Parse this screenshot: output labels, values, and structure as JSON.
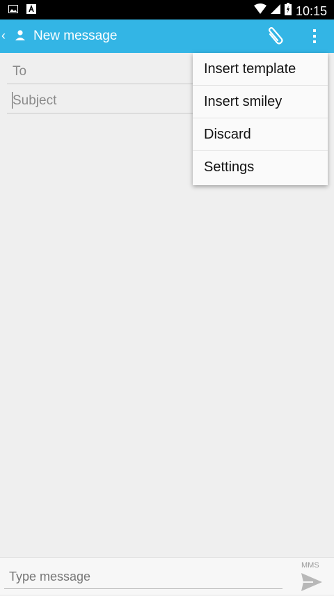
{
  "status_bar": {
    "time": "10:15",
    "icons": [
      "image-notification-icon",
      "a-notification-icon",
      "wifi-icon",
      "cell-signal-icon",
      "battery-icon"
    ]
  },
  "app_bar": {
    "title": "New message",
    "icons": [
      "back-chevron-icon",
      "person-icon",
      "paperclip-icon",
      "overflow-menu-icon"
    ],
    "background_color": "#33b5e5"
  },
  "fields": {
    "to_placeholder": "To",
    "subject_placeholder": "Subject"
  },
  "overflow_menu": {
    "items": [
      {
        "label": "Insert template"
      },
      {
        "label": "Insert smiley"
      },
      {
        "label": "Discard"
      },
      {
        "label": "Settings"
      }
    ]
  },
  "compose": {
    "placeholder": "Type message",
    "mode_label": "MMS",
    "send_icon": "send-icon"
  }
}
